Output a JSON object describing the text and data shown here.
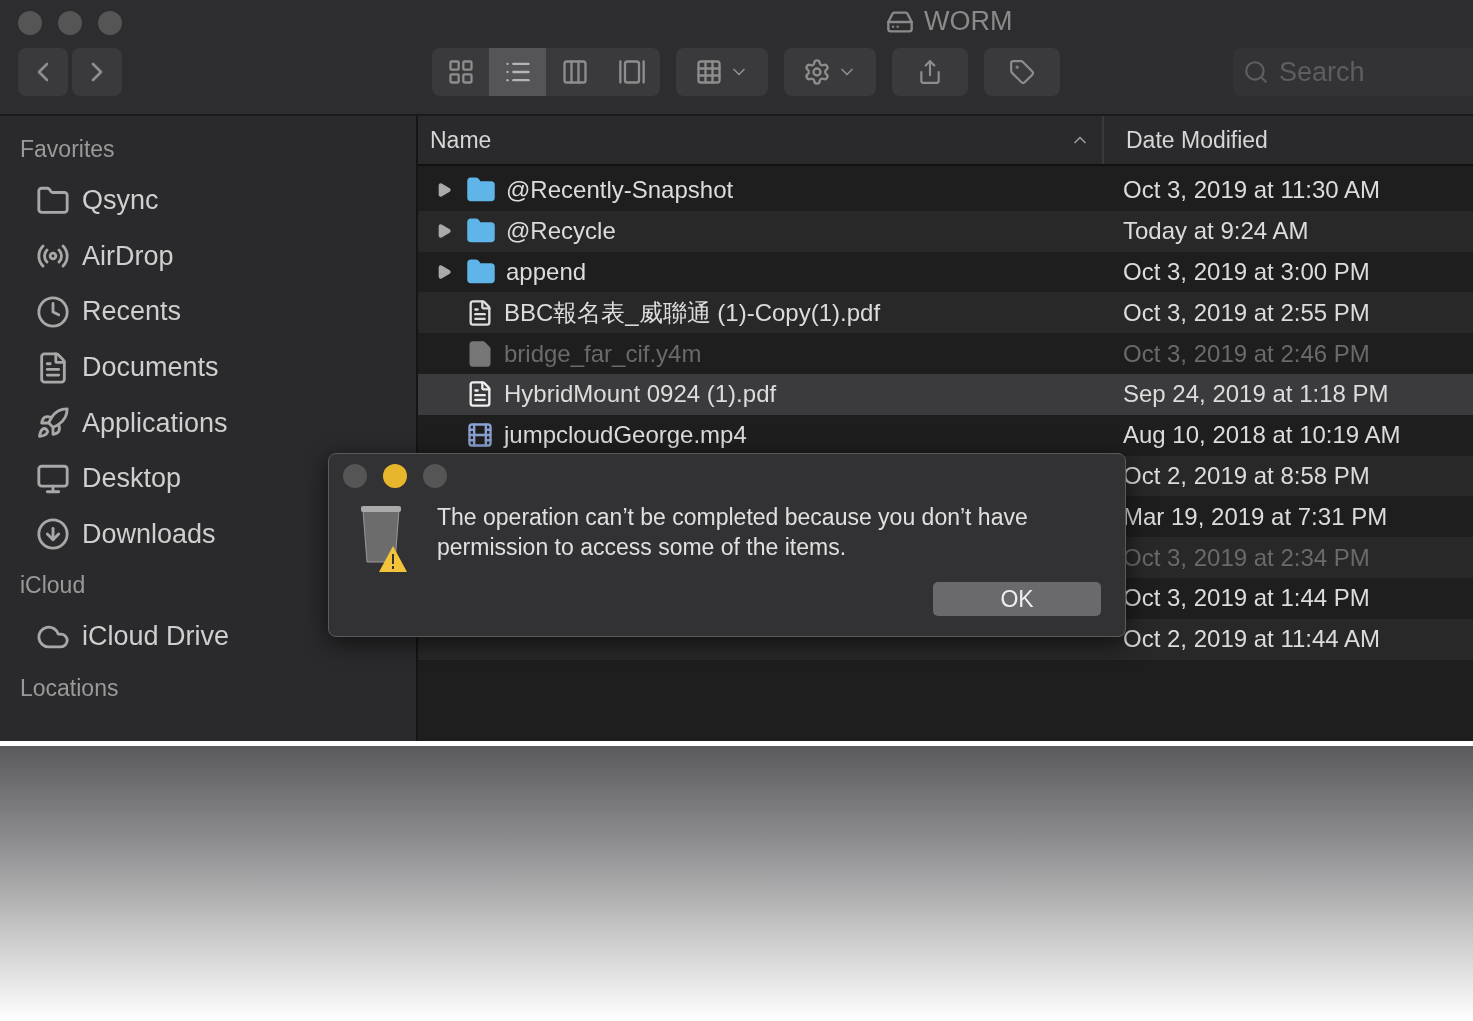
{
  "window": {
    "title": "WORM"
  },
  "toolbar": {
    "views": [
      {
        "kind": "icons",
        "selected": false
      },
      {
        "kind": "list",
        "selected": true
      },
      {
        "kind": "columns",
        "selected": false
      },
      {
        "kind": "gallery",
        "selected": false
      }
    ],
    "search": {
      "placeholder": "Search"
    }
  },
  "sidebar": {
    "sections": [
      {
        "title": "Favorites",
        "items": [
          {
            "label": "Qsync",
            "kind": "folder"
          },
          {
            "label": "AirDrop",
            "kind": "airdrop"
          },
          {
            "label": "Recents",
            "kind": "recents"
          },
          {
            "label": "Documents",
            "kind": "documents"
          },
          {
            "label": "Applications",
            "kind": "applications"
          },
          {
            "label": "Desktop",
            "kind": "desktop"
          },
          {
            "label": "Downloads",
            "kind": "downloads"
          }
        ]
      },
      {
        "title": "iCloud",
        "items": [
          {
            "label": "iCloud Drive",
            "kind": "cloud"
          }
        ]
      },
      {
        "title": "Locations"
      }
    ]
  },
  "table": {
    "columns": [
      {
        "label": "Name",
        "sorted": true
      },
      {
        "label": "Date Modified",
        "sorted": false
      }
    ],
    "rows": [
      {
        "name": "@Recently-Snapshot",
        "kind": "folder",
        "date": "Oct 3, 2019 at 11:30 AM",
        "selected": false,
        "dimmed": false
      },
      {
        "name": "@Recycle",
        "kind": "folder",
        "date": "Today at 9:24 AM",
        "selected": false,
        "dimmed": false
      },
      {
        "name": "append",
        "kind": "folder",
        "date": "Oct 3, 2019 at 3:00 PM",
        "selected": false,
        "dimmed": false
      },
      {
        "name": "BBC報名表_威聯通 (1)-Copy(1).pdf",
        "kind": "pdf",
        "date": "Oct 3, 2019 at 2:55 PM",
        "selected": false,
        "dimmed": false
      },
      {
        "name": "bridge_far_cif.y4m",
        "kind": "file",
        "date": "Oct 3, 2019 at 2:46 PM",
        "selected": false,
        "dimmed": true
      },
      {
        "name": "HybridMount 0924 (1).pdf",
        "kind": "pdfwide",
        "date": "Sep 24, 2019 at 1:18 PM",
        "selected": true,
        "dimmed": false
      },
      {
        "name": "jumpcloudGeorge.mp4",
        "kind": "video",
        "date": "Aug 10, 2018 at 10:19 AM",
        "selected": false,
        "dimmed": false
      },
      {
        "kind": "hidden",
        "date": "Oct 2, 2019 at 8:58 PM",
        "selected": false,
        "dimmed": false
      },
      {
        "kind": "hidden",
        "date": "Mar 19, 2019 at 7:31 PM",
        "selected": false,
        "dimmed": false
      },
      {
        "kind": "hidden",
        "date": "Oct 3, 2019 at 2:34 PM",
        "selected": false,
        "dimmed": true
      },
      {
        "kind": "hidden",
        "date": "Oct 3, 2019 at 1:44 PM",
        "selected": false,
        "dimmed": false
      },
      {
        "kind": "hidden",
        "date": "Oct 2, 2019 at 11:44 AM",
        "selected": false,
        "dimmed": false
      }
    ]
  },
  "dialog": {
    "message": "The operation can’t be completed because you don’t have permission to access some of the items.",
    "buttons": [
      "OK"
    ]
  }
}
